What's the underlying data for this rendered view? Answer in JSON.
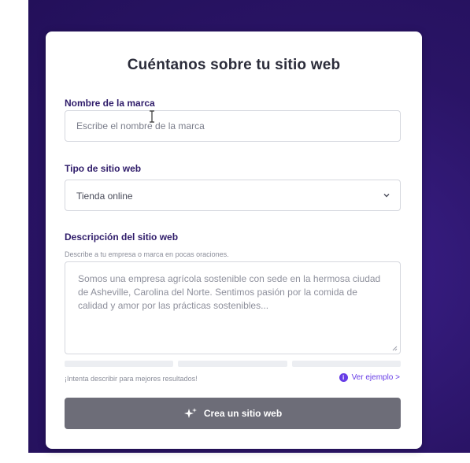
{
  "title": "Cuéntanos sobre tu sitio web",
  "brand": {
    "label": "Nombre de la marca",
    "placeholder": "Escribe el nombre de la marca"
  },
  "site_type": {
    "label": "Tipo de sitio web",
    "selected": "Tienda online"
  },
  "description": {
    "label": "Descripción del sitio web",
    "hint": "Describe a tu empresa o marca en pocas oraciones.",
    "placeholder": "Somos una empresa agrícola sostenible con sede en la hermosa ciudad de Asheville, Carolina del Norte. Sentimos pasión por la comida de calidad y amor por las prácticas sostenibles..."
  },
  "footer": {
    "tip": "¡Intenta describir para mejores resultados!",
    "example_link": "Ver ejemplo >"
  },
  "submit_label": "Crea un sitio web",
  "colors": {
    "background": "#2a1466",
    "accent": "#673de6",
    "button": "#6d6d78"
  }
}
